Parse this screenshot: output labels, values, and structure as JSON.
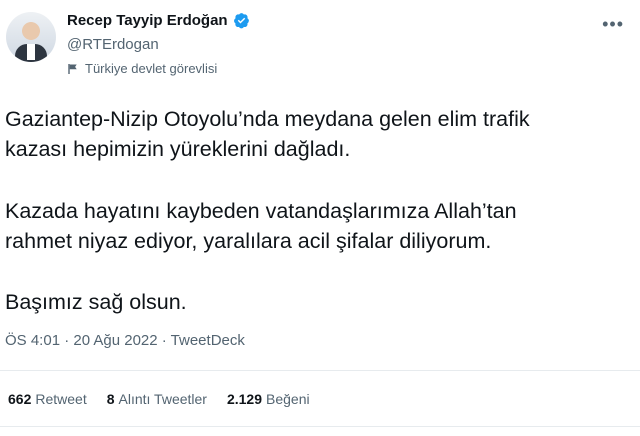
{
  "author": {
    "name": "Recep Tayyip Erdoğan",
    "handle": "@RTErdogan",
    "label": "Türkiye devlet görevlisi",
    "verified_color": "#1d9bf0"
  },
  "tweet": {
    "paragraphs": [
      [
        "Gaziantep-Nizip Otoyolu’nda meydana gelen elim trafik",
        "kazası hepimizin yüreklerini dağladı."
      ],
      [
        "Kazada hayatını kaybeden vatandaşlarımıza Allah’tan",
        "rahmet niyaz ediyor, yaralılara acil şifalar diliyorum."
      ],
      [
        "Başımız sağ olsun."
      ]
    ],
    "meta": "ÖS 4:01 · 20 Ağu 2022 · TweetDeck"
  },
  "stats": {
    "retweets_count": "662",
    "retweets_label": "Retweet",
    "quotes_count": "8",
    "quotes_label": "Alıntı Tweetler",
    "likes_count": "2.129",
    "likes_label": "Beğeni"
  },
  "icons": {
    "more": "more-icon",
    "verified": "verified-badge-icon",
    "label": "flag-icon"
  }
}
